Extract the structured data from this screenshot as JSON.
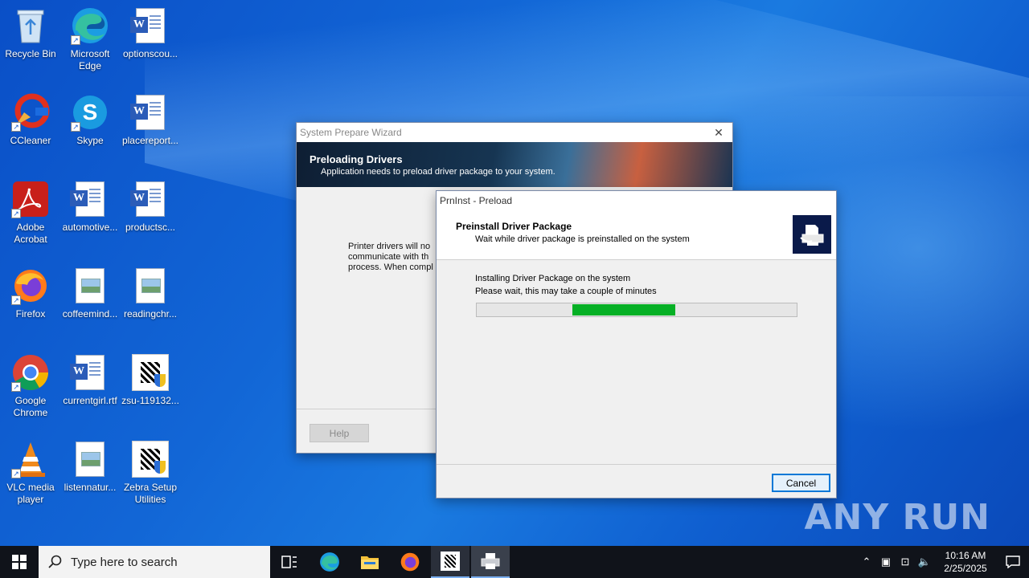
{
  "desktop": {
    "icons": [
      {
        "label": "Recycle Bin"
      },
      {
        "label": "Microsoft Edge"
      },
      {
        "label": "optionscou..."
      },
      {
        "label": "CCleaner"
      },
      {
        "label": "Skype"
      },
      {
        "label": "placereport..."
      },
      {
        "label": "Adobe Acrobat"
      },
      {
        "label": "automotive..."
      },
      {
        "label": "productsc..."
      },
      {
        "label": "Firefox"
      },
      {
        "label": "coffeemind..."
      },
      {
        "label": "readingchr..."
      },
      {
        "label": "Google Chrome"
      },
      {
        "label": "currentgirl.rtf"
      },
      {
        "label": "zsu-119132..."
      },
      {
        "label": "VLC media player"
      },
      {
        "label": "listennatur..."
      },
      {
        "label": "Zebra Setup Utilities"
      }
    ]
  },
  "wizard": {
    "title": "System Prepare Wizard",
    "header_title": "Preloading Drivers",
    "header_subtitle": "Application needs to preload driver package to your system.",
    "body_lines": [
      "Printer drivers will no",
      "communicate with th",
      "process. When compl"
    ],
    "help_label": "Help"
  },
  "preload": {
    "title": "PrnInst - Preload",
    "header_title": "Preinstall Driver Package",
    "header_subtitle": "Wait while driver package is preinstalled on the system",
    "status_line1": "Installing Driver Package on the system",
    "status_line2": "Please wait, this may take a couple of minutes",
    "progress_start": 0.3,
    "progress_end": 0.62,
    "cancel_label": "Cancel"
  },
  "taskbar": {
    "search_placeholder": "Type here to search",
    "time": "10:16 AM",
    "date": "2/25/2025"
  },
  "watermark": "ANY RUN",
  "colors": {
    "progress": "#06b025",
    "accent": "#0078d7"
  }
}
